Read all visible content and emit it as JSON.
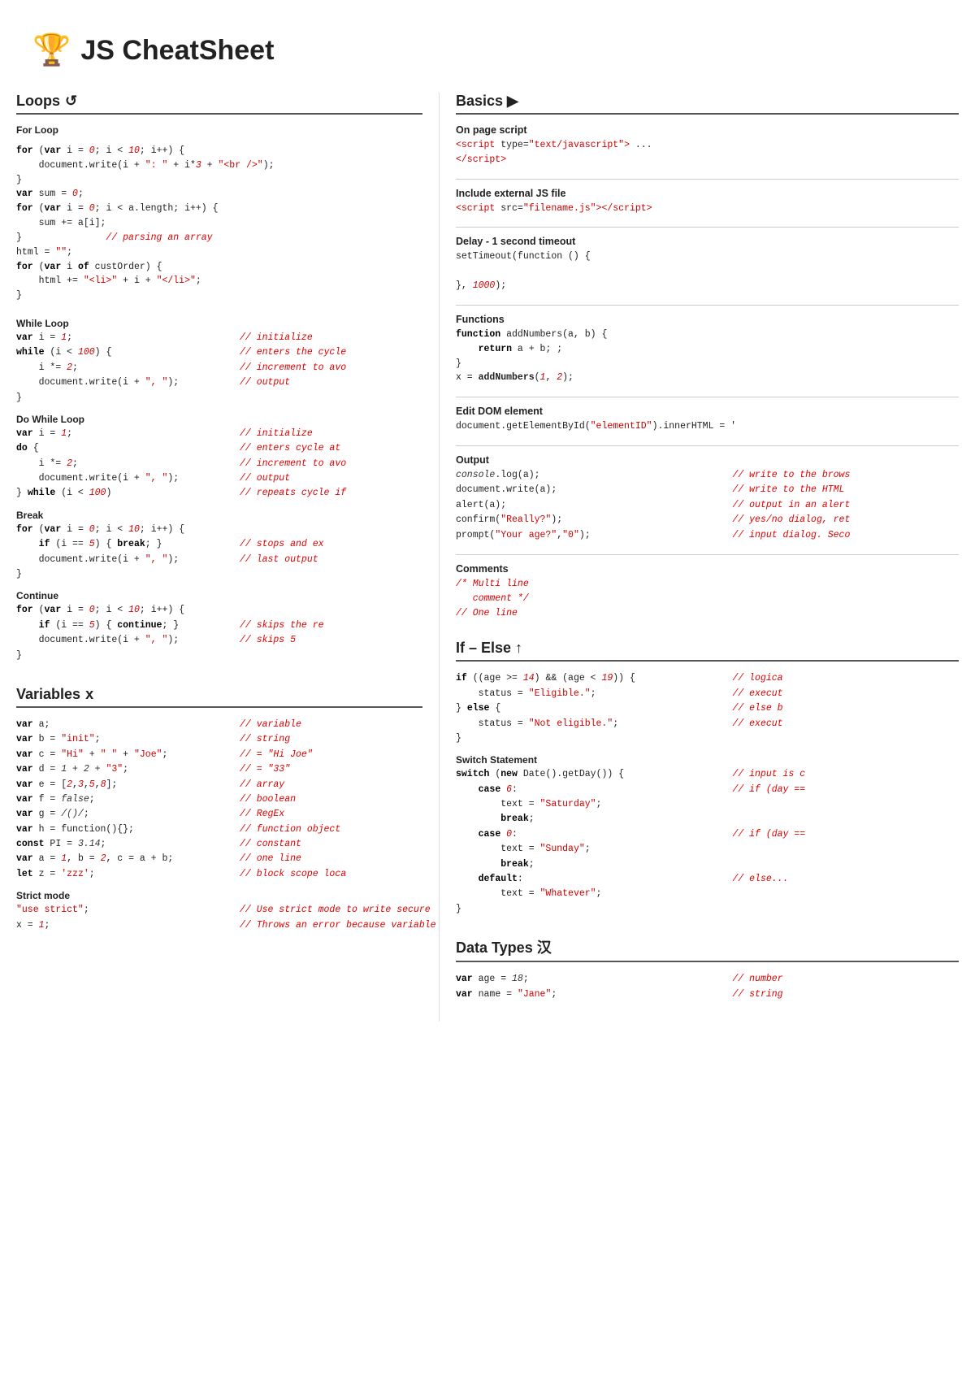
{
  "header": {
    "icon": "🏆",
    "title": "JS CheatSheet"
  },
  "left": {
    "sections": [
      {
        "id": "loops",
        "title": "Loops",
        "icon": "↺"
      },
      {
        "id": "variables",
        "title": "Variables",
        "icon": "x"
      }
    ]
  },
  "right": {
    "sections": [
      {
        "id": "basics",
        "title": "Basics ▶"
      },
      {
        "id": "ifelse",
        "title": "If – Else ↑"
      },
      {
        "id": "datatypes",
        "title": "Data Types 汉"
      }
    ]
  }
}
